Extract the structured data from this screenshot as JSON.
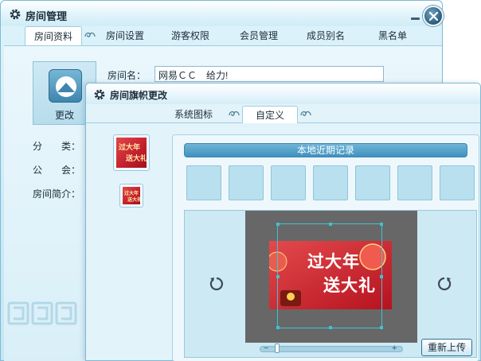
{
  "room_window": {
    "title": "房间管理",
    "tabs": [
      "房间资料",
      "房间设置",
      "游客权限",
      "会员管理",
      "成员别名",
      "黑名单"
    ],
    "active_tab": "房间资料",
    "avatar_change_label": "更改",
    "room_name_label": "房间名：",
    "room_name_value": "网易ＣＣ　给力!",
    "category_label": "分　　类：",
    "guild_label": "公　　会：",
    "intro_label": "房间简介："
  },
  "banner_window": {
    "title": "房间旗帜更改",
    "tabs": [
      "系统图标",
      "自定义"
    ],
    "active_tab": "自定义",
    "recent_label": "本地近期记录",
    "recent_slot_count": 7,
    "banner_text_line1": "过大年",
    "banner_text_line2": "送大礼",
    "zoom_minus": "−",
    "zoom_plus": "+",
    "zoom_level": 0.1,
    "reupload_label": "重新上传"
  },
  "colors": {
    "title_text": "#1c2d3a",
    "accent_blue": "#3f92bf",
    "crop_border": "#3ec3d3",
    "banner_red": "#c21f2b",
    "banner_text": "#ffe9a8"
  },
  "icons": {
    "title_icon": "gear-icon",
    "close": "close-icon",
    "minimize": "minimize-icon",
    "rotate_left": "rotate-left-icon",
    "rotate_right": "rotate-right-icon",
    "tab_separator": "swirl-decoration-icon"
  }
}
